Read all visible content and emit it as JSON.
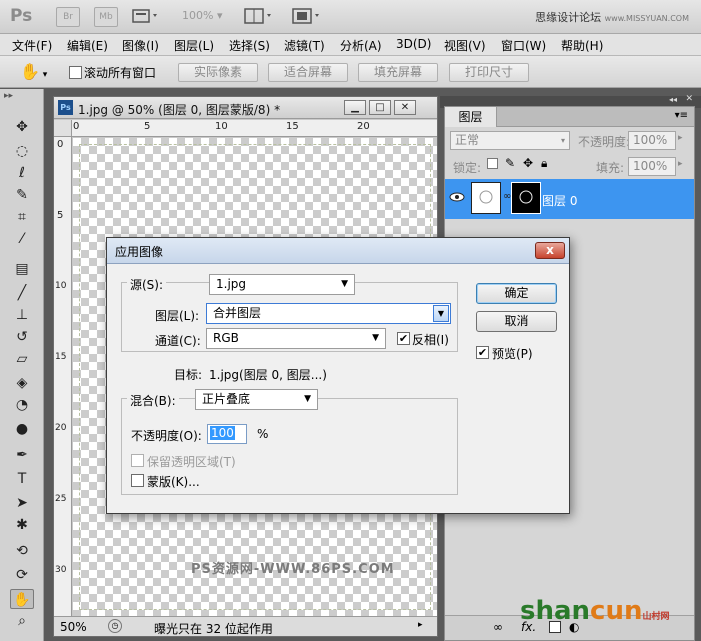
{
  "appbar": {
    "logo": "Ps",
    "br_label": "Br",
    "mb_label": "Mb",
    "zoom": "100%",
    "brand": "思缘设计论坛",
    "brand_url": "www.MISSYUAN.COM"
  },
  "menu": [
    "文件(F)",
    "编辑(E)",
    "图像(I)",
    "图层(L)",
    "选择(S)",
    "滤镜(T)",
    "分析(A)",
    "3D(D)",
    "视图(V)",
    "窗口(W)",
    "帮助(H)"
  ],
  "options": {
    "scroll_all_label": "滚动所有窗口",
    "buttons": [
      "实际像素",
      "适合屏幕",
      "填充屏幕",
      "打印尺寸"
    ]
  },
  "document": {
    "title": "1.jpg @ 50% (图层 0, 图层蒙版/8) *",
    "ruler_h": [
      "0",
      "5",
      "10",
      "15",
      "20"
    ],
    "ruler_v": [
      "0",
      "5",
      "10",
      "15",
      "20",
      "25",
      "30"
    ],
    "zoom": "50%",
    "status": "曝光只在 32 位起作用",
    "watermark": "PS资源网-WWW.86PS.COM"
  },
  "layers_panel": {
    "tab": "图层",
    "blend_mode": "正常",
    "opacity_label": "不透明度:",
    "opacity_value": "100%",
    "lock_label": "锁定:",
    "fill_label": "填充:",
    "fill_value": "100%",
    "layer_name": "图层 0",
    "footer_fx": "fx."
  },
  "site_logo": {
    "main": "shan",
    "accent": "cun",
    "sub": "山村网"
  },
  "dialog": {
    "title": "应用图像",
    "close": "x",
    "source_label": "源(S):",
    "source_value": "1.jpg",
    "layer_label": "图层(L):",
    "layer_value": "合并图层",
    "channel_label": "通道(C):",
    "channel_value": "RGB",
    "invert_label": "反相(I)",
    "invert_checked": true,
    "target_label": "目标:",
    "target_value": "1.jpg(图层 0, 图层...)",
    "blend_label": "混合(B):",
    "blend_value": "正片叠底",
    "opacity_label": "不透明度(O):",
    "opacity_value": "100",
    "opacity_unit": "%",
    "preserve_label": "保留透明区域(T)",
    "mask_label": "蒙版(K)...",
    "ok": "确定",
    "cancel": "取消",
    "preview_label": "预览(P)",
    "preview_checked": true
  }
}
